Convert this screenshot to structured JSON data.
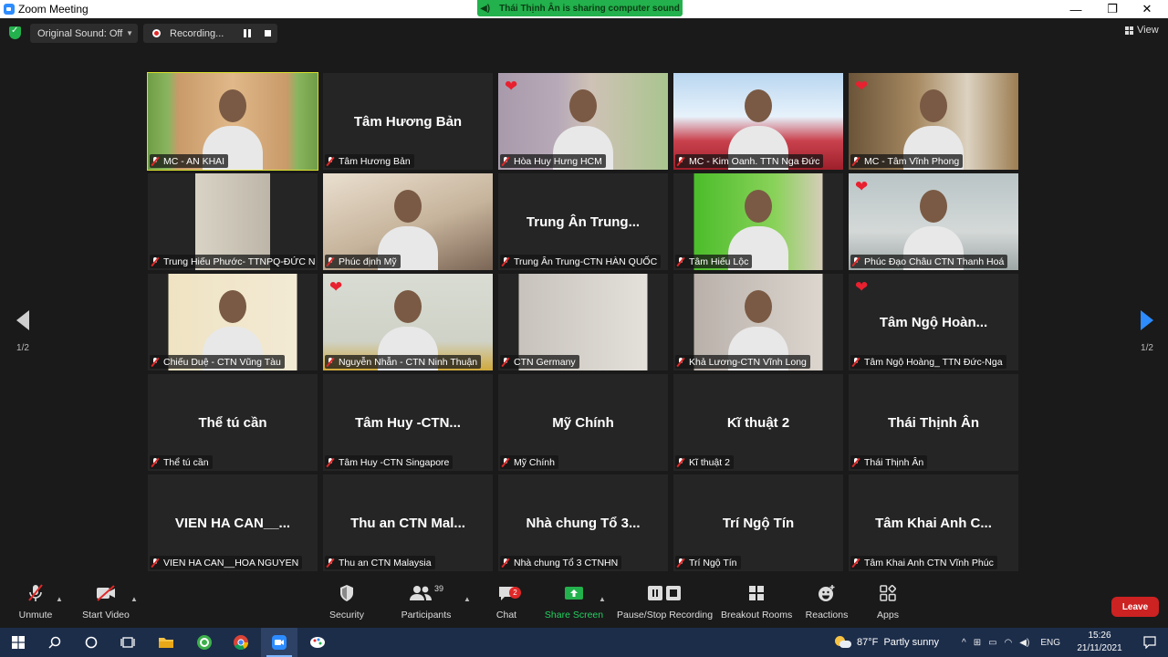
{
  "window": {
    "title": "Zoom Meeting",
    "minimize": "—",
    "maximize": "❐",
    "close": "✕"
  },
  "share_banner": "Thái Thịnh Ân is sharing computer sound",
  "top_toolbar": {
    "original_sound": "Original Sound: Off",
    "recording": "Recording...",
    "view": "View"
  },
  "nav": {
    "page_left": "1/2",
    "page_right": "1/2"
  },
  "tiles": [
    {
      "label": "MC - AN KHAI",
      "big": "",
      "heart": false,
      "active": true
    },
    {
      "label": "Tâm Hương Bản",
      "big": "Tâm Hương Bản",
      "heart": false,
      "active": false
    },
    {
      "label": "Hòa Huy Hưng HCM",
      "big": "",
      "heart": true,
      "active": false
    },
    {
      "label": "MC - Kim Oanh. TTN Nga Đức",
      "big": "",
      "heart": false,
      "active": false
    },
    {
      "label": "MC - Tâm Vĩnh Phong",
      "big": "",
      "heart": true,
      "active": false
    },
    {
      "label": "Trung Hiếu Phước- TTNPQ-ĐỨC N...",
      "big": "",
      "heart": false,
      "active": false
    },
    {
      "label": "Phúc định Mỹ",
      "big": "",
      "heart": false,
      "active": false
    },
    {
      "label": "Trung Ân Trung-CTN HÀN QUỐC",
      "big": "Trung Ân Trung...",
      "heart": false,
      "active": false
    },
    {
      "label": "Tâm Hiếu Lộc",
      "big": "",
      "heart": false,
      "active": false
    },
    {
      "label": "Phúc Đạo Châu CTN Thanh Hoá",
      "big": "",
      "heart": true,
      "active": false
    },
    {
      "label": "Chiếu Duệ - CTN Vũng Tàu",
      "big": "",
      "heart": false,
      "active": false
    },
    {
      "label": "Nguyễn Nhẫn - CTN Ninh Thuận",
      "big": "",
      "heart": true,
      "active": false
    },
    {
      "label": "CTN Germany",
      "big": "",
      "heart": false,
      "active": false
    },
    {
      "label": "Khả Lương-CTN Vĩnh Long",
      "big": "",
      "heart": false,
      "active": false
    },
    {
      "label": "Tâm Ngộ Hoàng_ TTN Đức-Nga",
      "big": "Tâm Ngộ Hoàn...",
      "heart": true,
      "active": false
    },
    {
      "label": "Thể tú cần",
      "big": "Thể tú cần",
      "heart": false,
      "active": false
    },
    {
      "label": "Tâm Huy -CTN Singapore",
      "big": "Tâm Huy -CTN...",
      "heart": false,
      "active": false
    },
    {
      "label": "Mỹ Chính",
      "big": "Mỹ Chính",
      "heart": false,
      "active": false
    },
    {
      "label": "Kĩ thuật 2",
      "big": "Kĩ thuật 2",
      "heart": false,
      "active": false
    },
    {
      "label": "Thái Thịnh Ân",
      "big": "Thái Thịnh Ân",
      "heart": false,
      "active": false
    },
    {
      "label": "VIEN HA CAN__HOA NGUYEN",
      "big": "VIEN HA CAN__...",
      "heart": false,
      "active": false
    },
    {
      "label": "Thu an CTN Malaysia",
      "big": "Thu an CTN Mal...",
      "heart": false,
      "active": false
    },
    {
      "label": "Nhà chung Tổ 3 CTNHN",
      "big": "Nhà chung Tổ 3...",
      "heart": false,
      "active": false
    },
    {
      "label": "Trí Ngộ Tín",
      "big": "Trí Ngộ Tín",
      "heart": false,
      "active": false
    },
    {
      "label": "Tâm Khai Anh CTN Vĩnh Phúc",
      "big": "Tâm Khai Anh C...",
      "heart": false,
      "active": false
    }
  ],
  "toolbar": {
    "unmute": "Unmute",
    "start_video": "Start Video",
    "security": "Security",
    "participants": "Participants",
    "participants_count": "39",
    "chat": "Chat",
    "chat_badge": "2",
    "share_screen": "Share Screen",
    "recording": "Pause/Stop Recording",
    "breakout": "Breakout Rooms",
    "reactions": "Reactions",
    "apps": "Apps",
    "leave": "Leave"
  },
  "taskbar": {
    "weather": "87°F  Partly sunny",
    "lang": "ENG",
    "time": "15:26",
    "date": "21/11/2021"
  },
  "colors": {
    "accent": "#2d8cff",
    "active_speaker": "#d8e02c",
    "leave": "#cc2222",
    "banner": "#22b14c"
  }
}
